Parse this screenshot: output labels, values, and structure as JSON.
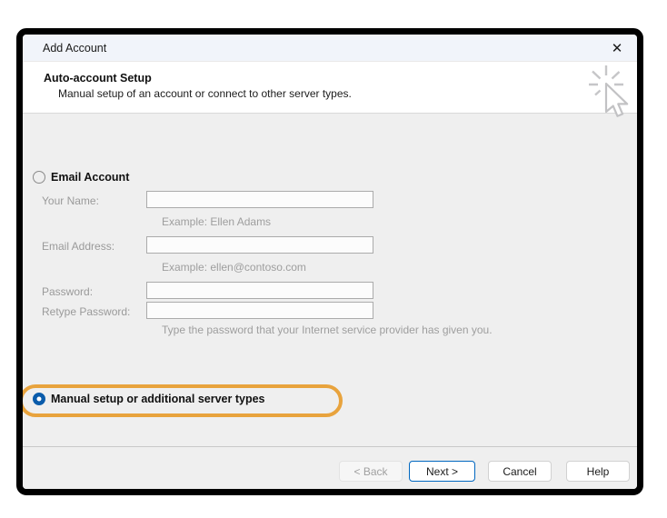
{
  "dialog": {
    "title": "Add Account",
    "close_icon": "✕",
    "header": {
      "title": "Auto-account Setup",
      "subtitle": "Manual setup of an account or connect to other server types."
    },
    "form": {
      "email_account_radio": {
        "label": "Email Account",
        "selected": false
      },
      "fields": [
        {
          "label": "Your Name:",
          "value": "",
          "hint": "Example: Ellen Adams"
        },
        {
          "label": "Email Address:",
          "value": "",
          "hint": "Example: ellen@contoso.com"
        },
        {
          "label": "Password:",
          "value": ""
        },
        {
          "label": "Retype Password:",
          "value": "",
          "hint": "Type the password that your Internet service provider has given you."
        }
      ],
      "manual_radio": {
        "label": "Manual setup or additional server types",
        "selected": true
      }
    },
    "footer": {
      "buttons": [
        {
          "label": "< Back",
          "state": "disabled"
        },
        {
          "label": "Next >",
          "state": "default"
        },
        {
          "label": "Cancel",
          "state": "normal"
        },
        {
          "label": "Help",
          "state": "normal"
        }
      ]
    }
  },
  "colors": {
    "accent_blue": "#0b5cab",
    "next_button_border": "#0067c0",
    "highlight_orange": "#e8a33d",
    "titlebar_bg": "#f1f4fa",
    "body_bg": "#efefef",
    "dialog_border": "#000000"
  }
}
